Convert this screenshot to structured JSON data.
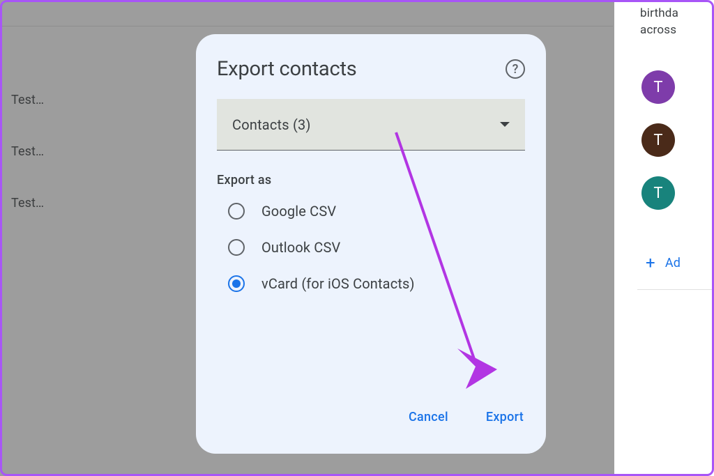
{
  "background": {
    "items": [
      "Test…",
      "Test…",
      "Test…"
    ]
  },
  "sidebar": {
    "text_lines": [
      "birthda",
      "across"
    ],
    "avatars": [
      {
        "initial": "T",
        "color": "#7e3caa"
      },
      {
        "initial": "T",
        "color": "#4a2a19"
      },
      {
        "initial": "T",
        "color": "#18837c"
      }
    ],
    "add_label": "Ad"
  },
  "dialog": {
    "title": "Export contacts",
    "dropdown_value": "Contacts (3)",
    "section_label": "Export as",
    "options": [
      {
        "label": "Google CSV",
        "selected": false
      },
      {
        "label": "Outlook CSV",
        "selected": false
      },
      {
        "label": "vCard (for iOS Contacts)",
        "selected": true
      }
    ],
    "cancel_label": "Cancel",
    "export_label": "Export"
  }
}
